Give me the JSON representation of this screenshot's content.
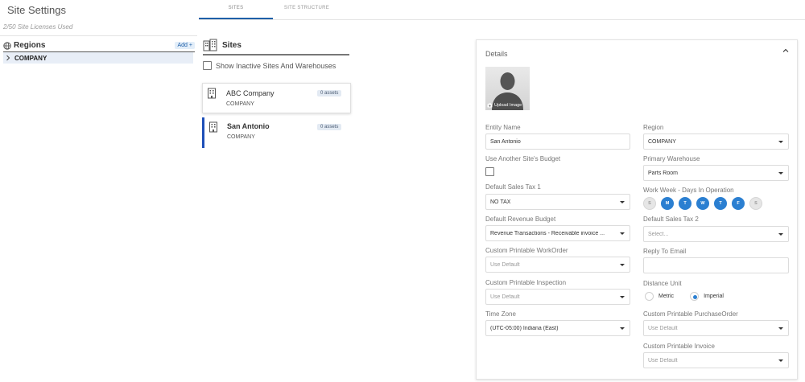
{
  "page": {
    "title": "Site Settings",
    "licenses": "2/50 Site Licenses Used"
  },
  "regions": {
    "title": "Regions",
    "add_label": "Add",
    "items": [
      {
        "label": "COMPANY"
      }
    ]
  },
  "tabs": [
    {
      "label": "SITES",
      "active": true
    },
    {
      "label": "SITE STRUCTURE",
      "active": false
    }
  ],
  "sites": {
    "title": "Sites",
    "show_inactive_label": "Show Inactive Sites And Warehouses",
    "show_inactive_checked": false,
    "items": [
      {
        "name": "ABC Company",
        "region": "COMPANY",
        "badge": "0 assets",
        "selected": false
      },
      {
        "name": "San Antonio",
        "region": "COMPANY",
        "badge": "0 assets",
        "selected": true
      }
    ]
  },
  "details": {
    "title": "Details",
    "upload_label": "Upload Image",
    "entity_name_label": "Entity Name",
    "entity_name_value": "San Antonio",
    "use_budget_label": "Use Another Site's Budget",
    "use_budget_checked": false,
    "sales_tax1_label": "Default Sales Tax 1",
    "sales_tax1_value": "NO TAX",
    "revenue_budget_label": "Default Revenue Budget",
    "revenue_budget_value": "Revenue Transactions - Receivable invoice ...",
    "printable_wo_label": "Custom Printable WorkOrder",
    "printable_wo_value": "Use Default",
    "printable_insp_label": "Custom Printable Inspection",
    "printable_insp_value": "Use Default",
    "timezone_label": "Time Zone",
    "timezone_value": "(UTC-05:00) Indiana (East)",
    "region_label": "Region",
    "region_value": "COMPANY",
    "primary_wh_label": "Primary Warehouse",
    "primary_wh_value": "Parts Room",
    "workweek_label": "Work Week - Days In Operation",
    "days": [
      {
        "label": "S",
        "on": false
      },
      {
        "label": "M",
        "on": true
      },
      {
        "label": "T",
        "on": true
      },
      {
        "label": "W",
        "on": true
      },
      {
        "label": "T",
        "on": true
      },
      {
        "label": "F",
        "on": true
      },
      {
        "label": "S",
        "on": false
      }
    ],
    "sales_tax2_label": "Default Sales Tax 2",
    "sales_tax2_placeholder": "Select...",
    "reply_email_label": "Reply To Email",
    "reply_email_value": "",
    "distance_label": "Distance Unit",
    "distance_metric": "Metric",
    "distance_imperial": "Imperial",
    "distance_selected": "Imperial",
    "printable_po_label": "Custom Printable PurchaseOrder",
    "printable_po_value": "Use Default",
    "printable_inv_label": "Custom Printable Invoice",
    "printable_inv_value": "Use Default"
  },
  "colors": {
    "accent": "#1e5fa8",
    "day_on": "#2b7fd1",
    "selected_bar": "#1e4fb8",
    "region_row_bg": "#e8eef7"
  },
  "icons": [
    "globe-icon",
    "chevron-right-icon",
    "buildings-icon",
    "building-icon",
    "camera-icon",
    "chevron-up-icon",
    "caret-down-icon"
  ]
}
